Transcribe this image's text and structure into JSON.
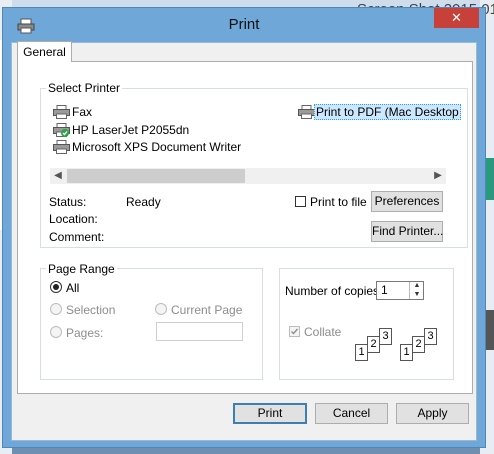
{
  "background": {
    "window_title": "Screen Shot 2015 01"
  },
  "dialog": {
    "title": "Print",
    "close_glyph": "✕"
  },
  "tabs": [
    {
      "label": "General",
      "selected": true
    }
  ],
  "select_printer": {
    "group_label": "Select Printer",
    "printers": [
      {
        "name": "Fax",
        "icon": "printer-icon"
      },
      {
        "name": "HP LaserJet P2055dn",
        "icon": "default-printer-icon",
        "default": true
      },
      {
        "name": "Microsoft XPS Document Writer",
        "icon": "printer-icon"
      },
      {
        "name": "Print to PDF (Mac Desktop",
        "icon": "printer-icon",
        "selected": true
      }
    ],
    "status_label": "Status:",
    "status_value": "Ready",
    "location_label": "Location:",
    "location_value": "",
    "comment_label": "Comment:",
    "comment_value": "",
    "print_to_file_label": "Print to file",
    "print_to_file_checked": false,
    "preferences_button": "Preferences",
    "find_printer_button": "Find Printer..."
  },
  "page_range": {
    "group_label": "Page Range",
    "all_label": "All",
    "selection_label": "Selection",
    "current_page_label": "Current Page",
    "pages_label": "Pages:",
    "pages_value": "",
    "selected": "All"
  },
  "copies": {
    "number_label": "Number of copies:",
    "number_value": "1",
    "collate_label": "Collate",
    "collate_checked": true,
    "collate_pages": [
      "1",
      "2",
      "3"
    ]
  },
  "footer": {
    "print_button": "Print",
    "cancel_button": "Cancel",
    "apply_button": "Apply"
  },
  "colors": {
    "accent_blue": "#3c7fb1",
    "close_red": "#c7403a",
    "title_bar": "#6ea7d8",
    "selection_bg": "#cce8ff"
  }
}
